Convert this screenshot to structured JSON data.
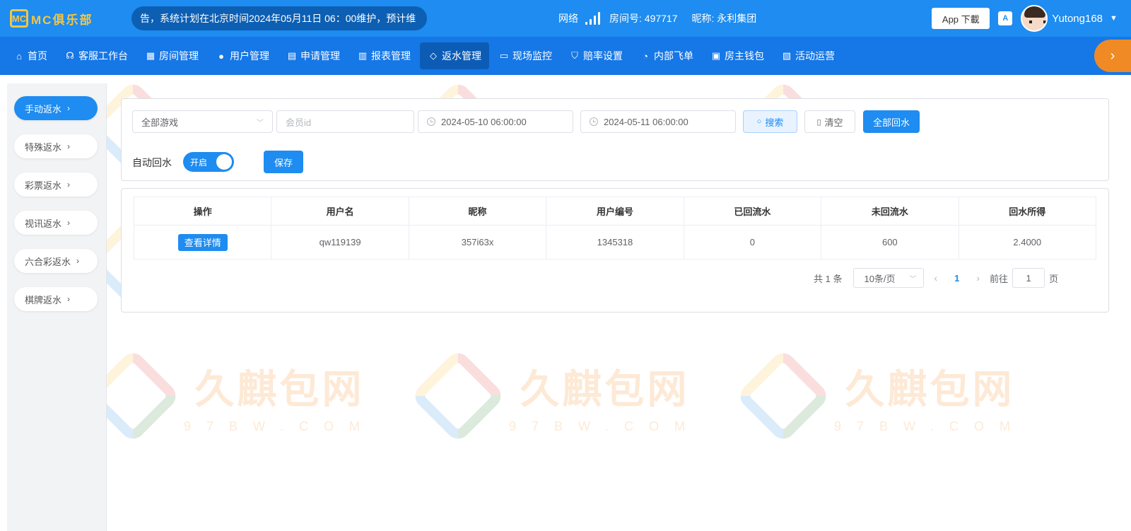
{
  "header": {
    "logo_mark": "MC",
    "logo_text": "MC俱乐部",
    "notice": "告，系统计划在北京时间2024年05月11日 06：00维护，预计维",
    "network_label": "网络",
    "room_label": "房间号: 497717",
    "nickname_label": "昵称: 永利集团",
    "app_download": "App 下載",
    "lang_icon": "A",
    "username": "Yutong168"
  },
  "nav": {
    "items": [
      {
        "label": "首页",
        "icon": "home-icon"
      },
      {
        "label": "客服工作台",
        "icon": "headset-icon"
      },
      {
        "label": "房间管理",
        "icon": "grid-icon"
      },
      {
        "label": "用户管理",
        "icon": "user-icon"
      },
      {
        "label": "申请管理",
        "icon": "document-icon"
      },
      {
        "label": "报表管理",
        "icon": "bar-chart-icon"
      },
      {
        "label": "返水管理",
        "icon": "tag-icon"
      },
      {
        "label": "现场监控",
        "icon": "monitor-icon"
      },
      {
        "label": "赔率设置",
        "icon": "shield-icon"
      },
      {
        "label": "内部飞单",
        "icon": "timer-icon"
      },
      {
        "label": "房主钱包",
        "icon": "wallet-icon"
      },
      {
        "label": "活动运营",
        "icon": "clipboard-icon"
      }
    ],
    "active_index": 6
  },
  "sidebar": {
    "items": [
      "手动返水",
      "特殊返水",
      "彩票返水",
      "视讯返水",
      "六合彩返水",
      "棋牌返水"
    ],
    "active_index": 0
  },
  "filters": {
    "game_select": "全部游戏",
    "member_id_placeholder": "会员id",
    "start_time": "2024-05-10 06:00:00",
    "end_time": "2024-05-11 06:00:00",
    "search": "搜索",
    "clear": "清空",
    "all_return": "全部回水",
    "auto_return_label": "自动回水",
    "toggle_text": "开启",
    "save": "保存"
  },
  "table": {
    "headers": [
      "操作",
      "用户名",
      "昵称",
      "用户编号",
      "已回流水",
      "未回流水",
      "回水所得"
    ],
    "rows": [
      {
        "action": "查看详情",
        "username": "qw119139",
        "nickname": "357i63x",
        "user_no": "1345318",
        "returned": "0",
        "unreturned": "600",
        "rebate": "2.4000"
      }
    ]
  },
  "pagination": {
    "total": "共 1 条",
    "page_size": "10条/页",
    "current_page": "1",
    "goto_label": "前往",
    "goto_value": "1",
    "page_suffix": "页"
  },
  "watermark": {
    "cn": "久麒包网",
    "en": "97BW.COM"
  },
  "colors": {
    "primary": "#1e8cf0",
    "nav_bg": "#1677e6",
    "accent_orange": "#f08a24",
    "logo_gold": "#f5c542"
  }
}
